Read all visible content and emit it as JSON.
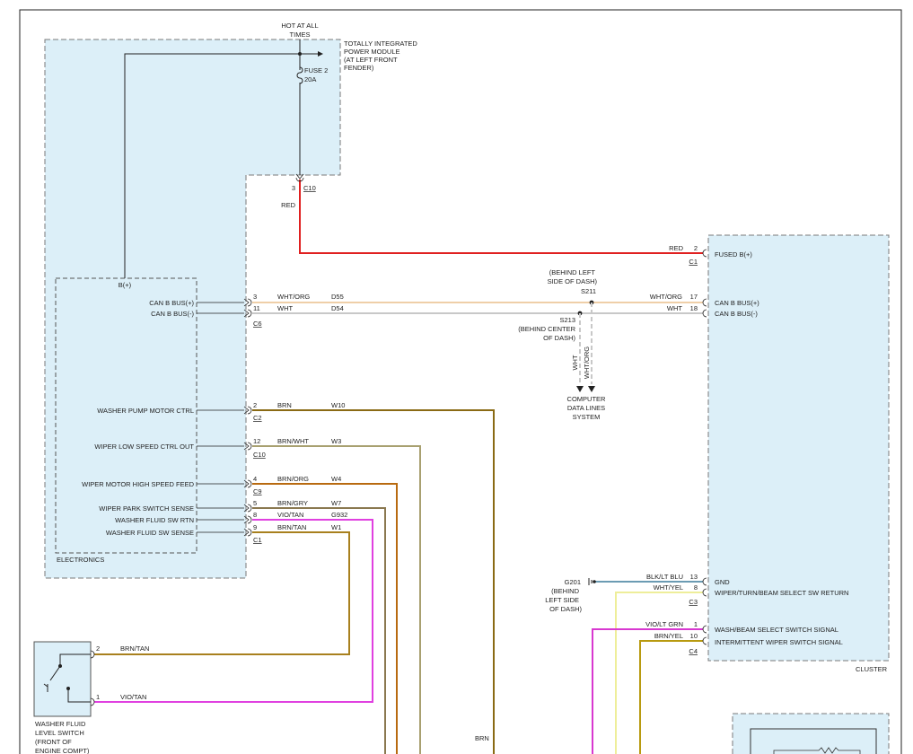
{
  "colors": {
    "module_fill": "#dceff8",
    "module_border": "#7a7a7a",
    "red": "#e02020",
    "wht_org": "#efcfa8",
    "wht": "#c8c8c8",
    "brn": "#8a6a14",
    "brn_wht": "#a8a070",
    "brn_org": "#b86a10",
    "brn_gry": "#8a7850",
    "vio_tan": "#e040e0",
    "brn_tan": "#a8801e",
    "blk_ltblu": "#3a7a9a",
    "wht_yel": "#eeee9a",
    "vio_ltgrn": "#d838d0",
    "brn_yel": "#b89a10",
    "black": "#222222"
  },
  "tipm": {
    "label1": "TOTALLY INTEGRATED",
    "label2": "POWER MODULE",
    "label3": "(AT LEFT FRONT",
    "label4": "FENDER)",
    "hot1": "HOT AT ALL",
    "hot2": "TIMES",
    "fuse": "FUSE 2",
    "amps": "20A",
    "pin": "3",
    "conn": "C10",
    "wire": "RED"
  },
  "ecm": {
    "label": "ELECTRONICS",
    "bplus": "B(+)",
    "pins": [
      {
        "name": "CAN B BUS(+)",
        "pin": "3",
        "color": "WHT/ORG",
        "circuit": "D55",
        "conn": ""
      },
      {
        "name": "CAN B BUS(-)",
        "pin": "11",
        "color": "WHT",
        "circuit": "D54",
        "conn": "C6"
      },
      {
        "name": "WASHER PUMP MOTOR CTRL",
        "pin": "2",
        "color": "BRN",
        "circuit": "W10",
        "conn": "C2"
      },
      {
        "name": "WIPER LOW SPEED CTRL OUT",
        "pin": "12",
        "color": "BRN/WHT",
        "circuit": "W3",
        "conn": "C10"
      },
      {
        "name": "WIPER MOTOR HIGH SPEED FEED",
        "pin": "4",
        "color": "BRN/ORG",
        "circuit": "W4",
        "conn": "C9"
      },
      {
        "name": "WIPER PARK SWITCH SENSE",
        "pin": "5",
        "color": "BRN/GRY",
        "circuit": "W7",
        "conn": ""
      },
      {
        "name": "WASHER FLUID SW RTN",
        "pin": "8",
        "color": "VIO/TAN",
        "circuit": "G932",
        "conn": ""
      },
      {
        "name": "WASHER FLUID SW SENSE",
        "pin": "9",
        "color": "BRN/TAN",
        "circuit": "W1",
        "conn": "C1"
      }
    ]
  },
  "cluster": {
    "label": "CLUSTER",
    "fused": {
      "name": "FUSED B(+)",
      "pin": "2",
      "color": "RED",
      "conn": "C1"
    },
    "canp": {
      "name": "CAN B BUS(+)",
      "pin": "17",
      "color": "WHT/ORG"
    },
    "canm": {
      "name": "CAN B BUS(-)",
      "pin": "18",
      "color": "WHT"
    },
    "gnd": {
      "name": "GND",
      "pin": "13",
      "color": "BLK/LT BLU"
    },
    "wtb": {
      "name": "WIPER/TURN/BEAM SELECT SW RETURN",
      "pin": "8",
      "color": "WHT/YEL",
      "conn": "C3"
    },
    "wbs": {
      "name": "WASH/BEAM SELECT SWITCH SIGNAL",
      "pin": "1",
      "color": "VIO/LT GRN"
    },
    "iws": {
      "name": "INTERMITTENT WIPER SWITCH SIGNAL",
      "pin": "10",
      "color": "BRN/YEL",
      "conn": "C4"
    }
  },
  "splices": {
    "s211": [
      "(BEHIND LEFT",
      "SIDE OF DASH)",
      "S211"
    ],
    "s213": [
      "S213",
      "(BEHIND CENTER",
      "OF DASH)"
    ],
    "drop_wht": "WHT",
    "drop_wht_org": "WHT/ORG",
    "cdl": [
      "COMPUTER",
      "DATA LINES",
      "SYSTEM"
    ]
  },
  "ground": {
    "name": "G201",
    "loc": [
      "(BEHIND",
      "LEFT SIDE",
      "OF DASH)"
    ]
  },
  "washer_switch": {
    "label": [
      "WASHER FLUID",
      "LEVEL SWITCH",
      "(FRONT OF",
      "ENGINE COMPT)"
    ],
    "pin2": "2",
    "pin2_color": "BRN/TAN",
    "pin1": "1",
    "pin1_color": "VIO/TAN"
  },
  "bottom_label": "BRN"
}
